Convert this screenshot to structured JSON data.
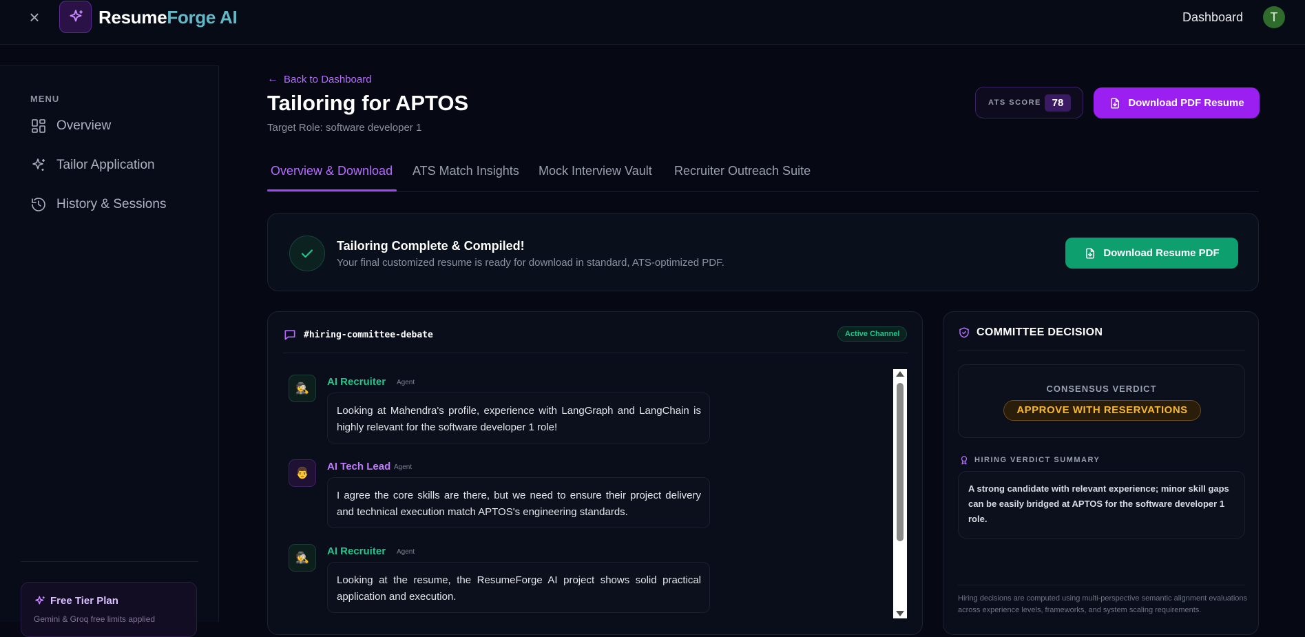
{
  "app": {
    "brand_part1": "Resume",
    "brand_part2": "Forge AI",
    "nav_dashboard": "Dashboard",
    "avatar_initial": "T",
    "accent": "#9a1ff0",
    "success": "#0e9f6e"
  },
  "sidebar": {
    "menu_label": "MENU",
    "items": [
      {
        "label": "Overview",
        "icon": "grid-icon"
      },
      {
        "label": "Tailor Application",
        "icon": "sparkle-icon"
      },
      {
        "label": "History & Sessions",
        "icon": "history-icon"
      }
    ],
    "plan": {
      "title": "Free Tier Plan",
      "subtitle": "Gemini & Groq free limits applied"
    }
  },
  "header": {
    "back_label": "Back to Dashboard",
    "title": "Tailoring for APTOS",
    "subtitle": "Target Role: software developer 1",
    "ats_label": "ATS SCORE",
    "ats_value": "78",
    "download_button": "Download PDF Resume"
  },
  "tabs": [
    {
      "label": "Overview & Download",
      "active": true
    },
    {
      "label": "ATS Match Insights",
      "active": false
    },
    {
      "label": "Mock Interview Vault",
      "active": false
    },
    {
      "label": "Recruiter Outreach Suite",
      "active": false
    }
  ],
  "status": {
    "title": "Tailoring Complete & Compiled!",
    "subtitle": "Your final customized resume is ready for download in standard, ATS-optimized PDF.",
    "button": "Download Resume PDF"
  },
  "chat": {
    "channel": "#hiring-committee-debate",
    "badge": "Active Channel",
    "messages": [
      {
        "sender": "AI Recruiter",
        "tag": "Agent",
        "avatar": "🕵",
        "text": "Looking at Mahendra's profile, experience with LangGraph and LangChain is highly relevant for the software developer 1 role!"
      },
      {
        "sender": "AI Tech Lead",
        "tag": "Agent",
        "avatar": "👨",
        "text": "I agree the core skills are there, but we need to ensure their project delivery and technical execution match APTOS's engineering standards."
      },
      {
        "sender": "AI Recruiter",
        "tag": "Agent",
        "avatar": "🕵",
        "text": "Looking at the resume, the ResumeForge AI project shows solid practical application and execution."
      }
    ]
  },
  "committee": {
    "title": "COMMITTEE DECISION",
    "consensus_label": "CONSENSUS VERDICT",
    "verdict": "APPROVE WITH RESERVATIONS",
    "summary_label": "HIRING VERDICT SUMMARY",
    "summary": "A strong candidate with relevant experience; minor skill gaps can be easily bridged at APTOS for the software developer 1 role.",
    "footnote": "Hiring decisions are computed using multi-perspective semantic alignment evaluations across experience levels, frameworks, and system scaling requirements."
  }
}
